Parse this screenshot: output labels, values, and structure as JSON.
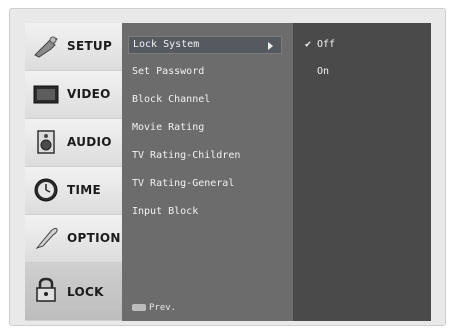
{
  "menu": {
    "items": [
      {
        "label": "SETUP",
        "icon": "setup-icon"
      },
      {
        "label": "VIDEO",
        "icon": "video-icon"
      },
      {
        "label": "AUDIO",
        "icon": "audio-icon"
      },
      {
        "label": "TIME",
        "icon": "time-icon"
      },
      {
        "label": "OPTION",
        "icon": "option-icon"
      },
      {
        "label": "LOCK",
        "icon": "lock-icon"
      }
    ],
    "active": "LOCK"
  },
  "submenu": {
    "items": [
      "Lock System",
      "Set Password",
      "Block Channel",
      "Movie Rating",
      "TV Rating-Children",
      "TV Rating-General",
      "Input Block"
    ],
    "selected": "Lock System",
    "prev_label": "Prev."
  },
  "options": {
    "items": [
      {
        "label": "Off",
        "checked": true
      },
      {
        "label": "On",
        "checked": false
      }
    ],
    "check_glyph": "✔"
  }
}
